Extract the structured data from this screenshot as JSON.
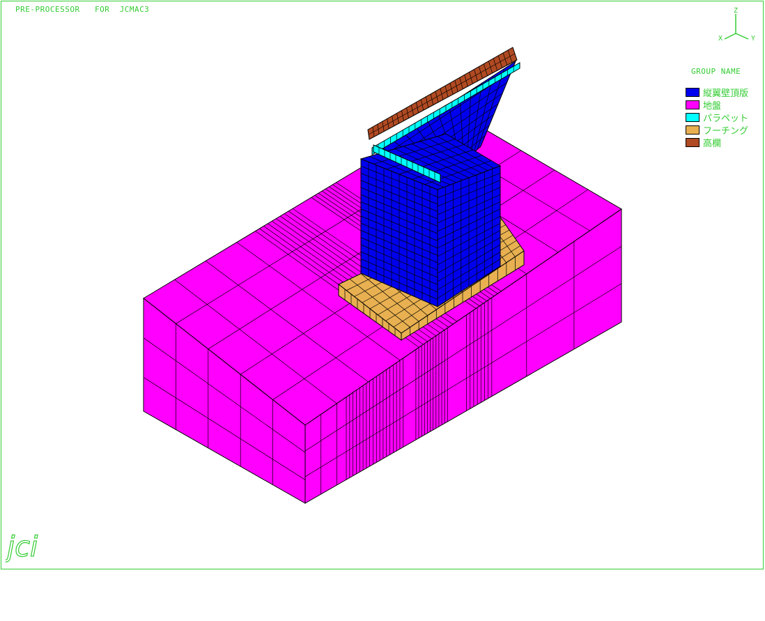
{
  "window": {
    "title": "PRE-PROCESSOR   FOR  JCMAC3",
    "frame_color": "#33cc33"
  },
  "axis_triad": {
    "z": "Z",
    "x": "X",
    "y": "Y",
    "color": "#33cc33"
  },
  "legend": {
    "title": "GROUP NAME",
    "items": [
      {
        "label": "縦翼壁頂版",
        "color": "#0000ee"
      },
      {
        "label": "地盤",
        "color": "#ff00ff"
      },
      {
        "label": "パラペット",
        "color": "#00ffff"
      },
      {
        "label": "フーチング",
        "color": "#e8b050"
      },
      {
        "label": "高欄",
        "color": "#b04a22"
      }
    ]
  },
  "logo": {
    "text": "jci",
    "color": "#33cc33"
  },
  "model": {
    "ground_color": "#ff00ff",
    "footing_color": "#e8b050",
    "wall_color": "#0000ee",
    "parapet_color": "#00ffff",
    "railing_color": "#b04a22",
    "mesh_color": "#000000"
  }
}
